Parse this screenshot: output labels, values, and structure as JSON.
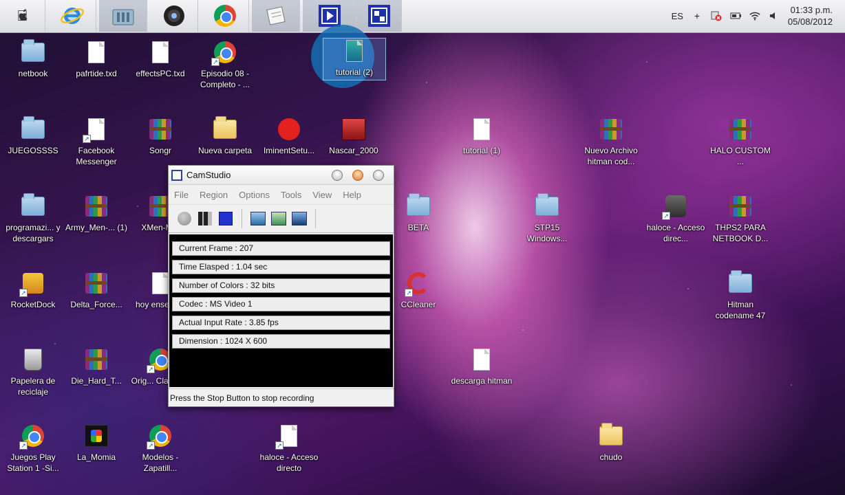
{
  "taskbar": {
    "apps": [
      {
        "name": "apple-menu",
        "icon": "apple-icon"
      },
      {
        "name": "internet-explorer",
        "icon": "internet-explorer-icon"
      },
      {
        "name": "libraries",
        "icon": "libraries-icon"
      },
      {
        "name": "webcam",
        "icon": "webcam-icon"
      },
      {
        "name": "chrome",
        "icon": "chrome-icon"
      },
      {
        "name": "notepad",
        "icon": "notepad-icon"
      },
      {
        "name": "camstudio-player",
        "icon": "play-icon"
      },
      {
        "name": "camstudio",
        "icon": "camstudio-icon"
      }
    ],
    "tray": {
      "language": "ES",
      "clock_time": "01:33 p.m.",
      "clock_date": "05/08/2012"
    }
  },
  "desktop": {
    "icons": [
      {
        "label": "netbook",
        "type": "folder"
      },
      {
        "label": "pafrtide.txd",
        "type": "document"
      },
      {
        "label": "effectsPC.txd",
        "type": "document"
      },
      {
        "label": "Episodio 08 - Completo - ...",
        "type": "chrome"
      },
      {
        "label": "tutorial (2)",
        "type": "document",
        "selected": true
      },
      {
        "label": "JUEGOSSSS",
        "type": "folder"
      },
      {
        "label": "Facebook Messenger",
        "type": "shortcut"
      },
      {
        "label": "Songr",
        "type": "archive"
      },
      {
        "label": "Nueva carpeta",
        "type": "folder-yellow"
      },
      {
        "label": "IminentSetu...",
        "type": "app"
      },
      {
        "label": "Nascar_2000",
        "type": "app"
      },
      {
        "label": "tutorial (1)",
        "type": "document"
      },
      {
        "label": "Nuevo Archivo hitman cod...",
        "type": "archive"
      },
      {
        "label": "HALO CUSTOM ...",
        "type": "archive"
      },
      {
        "label": "programazi... y descargars",
        "type": "folder"
      },
      {
        "label": "Army_Men-... (1)",
        "type": "archive"
      },
      {
        "label": "XMen-M...",
        "type": "archive"
      },
      {
        "label": "BETA",
        "type": "folder"
      },
      {
        "label": "STP15 Windows...",
        "type": "folder"
      },
      {
        "label": "haloce - Acceso direc...",
        "type": "shortcut"
      },
      {
        "label": "THPS2 PARA NETBOOK D...",
        "type": "archive"
      },
      {
        "label": "RocketDock",
        "type": "shortcut"
      },
      {
        "label": "Delta_Force...",
        "type": "archive"
      },
      {
        "label": "hoy enseña...",
        "type": "document"
      },
      {
        "label": "CCleaner",
        "type": "app"
      },
      {
        "label": "Hitman codename 47",
        "type": "folder"
      },
      {
        "label": "Papelera de reciclaje",
        "type": "recycle-bin"
      },
      {
        "label": "Die_Hard_T...",
        "type": "archive"
      },
      {
        "label": "Orig... Classic...",
        "type": "chrome"
      },
      {
        "label": "descarga hitman",
        "type": "video"
      },
      {
        "label": "Juegos Play Station 1 -Si...",
        "type": "chrome"
      },
      {
        "label": "La_Momia",
        "type": "app"
      },
      {
        "label": "Modelos - Zapatill...",
        "type": "chrome"
      },
      {
        "label": "haloce - Acceso directo",
        "type": "shortcut"
      },
      {
        "label": "chudo",
        "type": "folder-yellow"
      }
    ]
  },
  "camstudio": {
    "title": "CamStudio",
    "menu": [
      "File",
      "Region",
      "Options",
      "Tools",
      "View",
      "Help"
    ],
    "stats": [
      "Current Frame : 207",
      "Time Elasped : 1.04 sec",
      "Number of Colors : 32 bits",
      "Codec : MS Video 1",
      "Actual Input Rate : 3.85 fps",
      "Dimension : 1024 X 600"
    ],
    "status": "Press the Stop Button to stop recording"
  }
}
